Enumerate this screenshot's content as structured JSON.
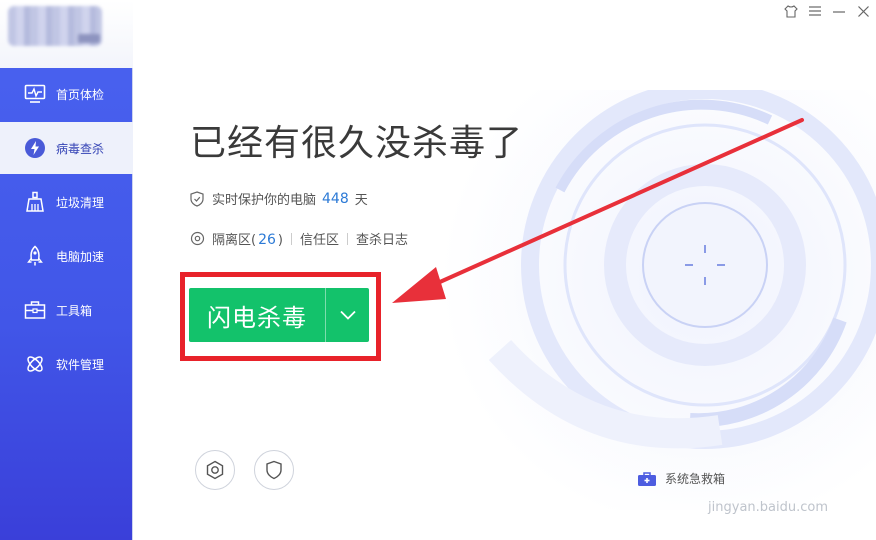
{
  "window": {
    "controls": [
      "skin-icon",
      "menu-icon",
      "minimize-icon",
      "close-icon"
    ]
  },
  "sidebar": {
    "items": [
      {
        "label": "首页体检",
        "icon": "monitor-icon"
      },
      {
        "label": "病毒查杀",
        "icon": "lightning-shield-icon",
        "active": true
      },
      {
        "label": "垃圾清理",
        "icon": "broom-icon"
      },
      {
        "label": "电脑加速",
        "icon": "rocket-icon"
      },
      {
        "label": "工具箱",
        "icon": "toolbox-icon"
      },
      {
        "label": "软件管理",
        "icon": "apps-icon"
      }
    ]
  },
  "main": {
    "title": "已经有很久没杀毒了",
    "protect": {
      "text": "实时保护你的电脑",
      "days": "448",
      "unit": "天"
    },
    "links": {
      "quarantine": "隔离区",
      "quarantine_open": "(",
      "quarantine_count": "26",
      "quarantine_close": ")",
      "trust": "信任区",
      "log": "查杀日志"
    },
    "scan_button": "闪电杀毒"
  },
  "bottom": {
    "first_aid_label": "系统急救箱",
    "watermark": "jingyan.baidu.com"
  },
  "colors": {
    "accent": "#13c26b",
    "highlight": "#e8222a",
    "arrow": "#e8303a",
    "sidebar": "#4156e8",
    "number": "#2c7ad6"
  }
}
